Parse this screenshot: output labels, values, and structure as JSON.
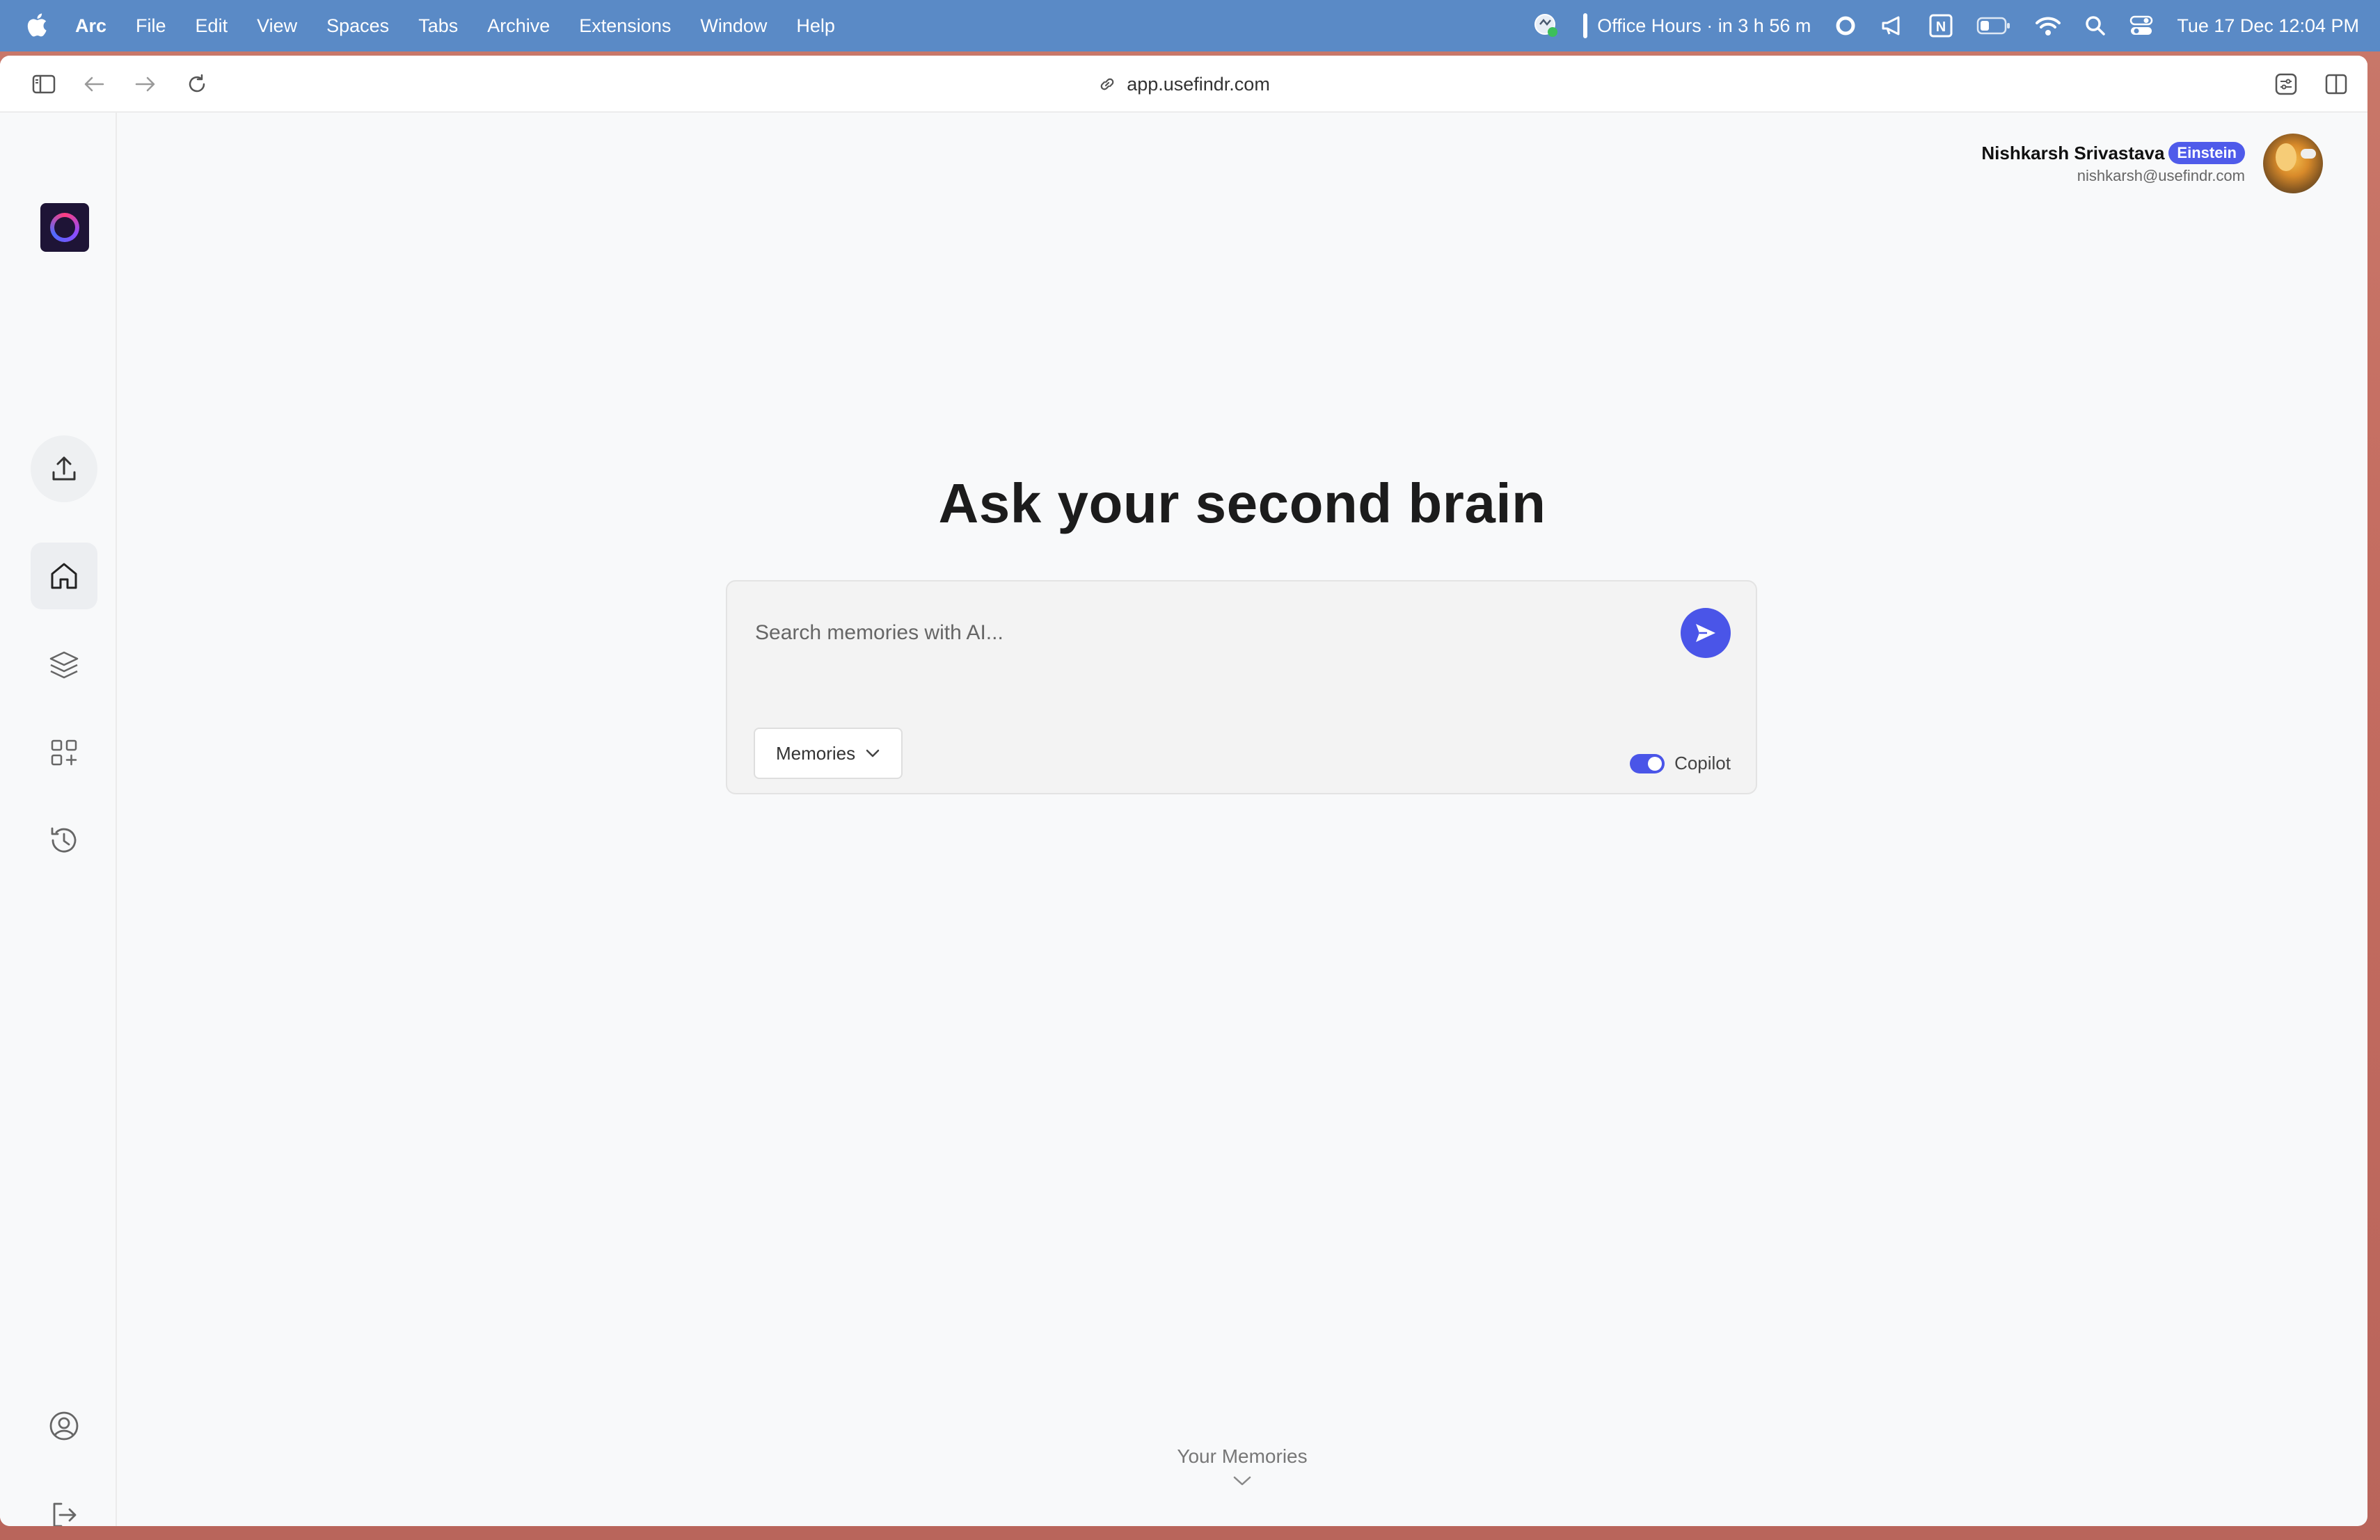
{
  "menubar": {
    "app_name": "Arc",
    "menus": [
      "File",
      "Edit",
      "View",
      "Spaces",
      "Tabs",
      "Archive",
      "Extensions",
      "Window",
      "Help"
    ],
    "meeting": "Office Hours · in 3 h 56 m",
    "notion_letter": "N",
    "datetime": "Tue 17 Dec  12:04 PM"
  },
  "browser": {
    "url": "app.usefindr.com"
  },
  "user": {
    "name": "Nishkarsh Srivastava",
    "plan": "Einstein",
    "email": "nishkarsh@usefindr.com"
  },
  "main": {
    "headline": "Ask your second brain",
    "search_placeholder": "Search memories with AI...",
    "scope_label": "Memories",
    "copilot_label": "Copilot",
    "copilot_enabled": true,
    "memories_link": "Your Memories"
  },
  "colors": {
    "accent": "#4a55e8",
    "menubar": "#5a8ac6",
    "badge": "#4f5bea"
  },
  "icons": {
    "sidebar": [
      "upload-icon",
      "home-icon",
      "layers-icon",
      "add-widget-icon",
      "history-icon",
      "account-icon",
      "logout-icon"
    ]
  }
}
